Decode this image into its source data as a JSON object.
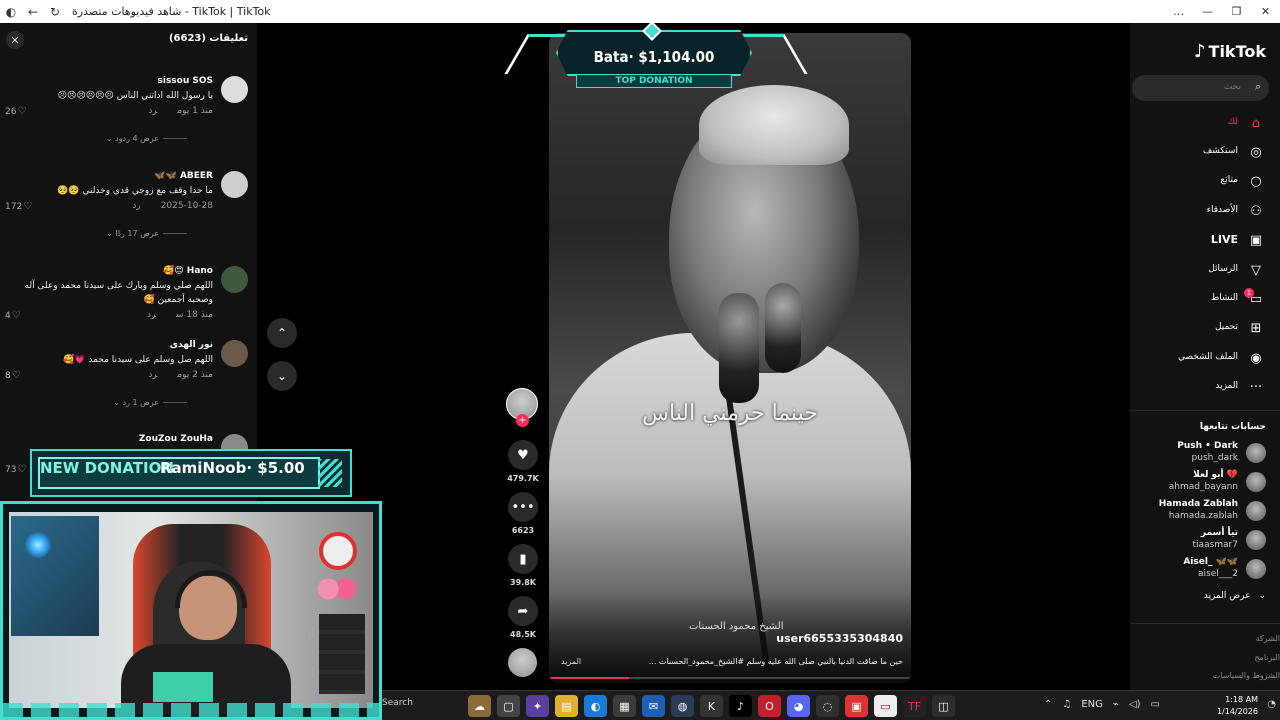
{
  "browser": {
    "title": "شاهد فيديوهات متصدرة - TikTok | TikTok",
    "icons": [
      "tiktok-favicon",
      "back-icon",
      "refresh-icon"
    ],
    "window_buttons": [
      "…",
      "—",
      "❐",
      "✕"
    ]
  },
  "comments_panel": {
    "title": "تعليقات (6623)",
    "close_label": "✕",
    "comments": [
      {
        "user": "sissou SOS",
        "text": "يا رسول الله اداتني الناس 😣😣😣😣😣😣",
        "meta": "منذ 1 يوم",
        "reply": "رد",
        "likes": "26",
        "replies": "عرض 4 ردود"
      },
      {
        "user": "ABEER 🦋🦋",
        "text": "ما حدا وقف مع زوجي قدي وخذلني 🥺🥺",
        "meta": "2025-10-28",
        "reply": "رد",
        "likes": "172",
        "replies": "عرض 17 ردًا"
      },
      {
        "user": "Hano 😍🥰",
        "text": "اللهم صلي وسلم وبارك على سيدنا محمد وعلى آله وصحبه أجمعين 🥰",
        "meta": "منذ 18 س",
        "reply": "رد",
        "likes": "4",
        "replies": ""
      },
      {
        "user": "نور الهدى",
        "text": "اللهم صل وسلم على سيدنا محمد 💗🥰",
        "meta": "منذ 2 يوم",
        "reply": "رد",
        "likes": "8",
        "replies": "عرض 1 رد"
      },
      {
        "user": "ZouZou ZouHa",
        "text": "",
        "meta": "",
        "reply": "",
        "likes": "73",
        "replies": ""
      }
    ]
  },
  "feed": {
    "nav_up": "⌃",
    "nav_down": "⌄",
    "video": {
      "overlay_text": "حينما حرمني الناس",
      "signature": "الشيخ محمود الحسنات",
      "username": "user6655335304840",
      "description": "حين ما ضاقت الدنيا بالنبي صلى الله عليه وسلم #الشيخ_محمود_الحسنات ...",
      "more": "المزيد",
      "progress": 0.22
    },
    "actions": {
      "follow": "+",
      "likes": "479.7K",
      "comments": "6623",
      "saves": "39.8K",
      "shares": "48.5K"
    }
  },
  "overlays": {
    "top_donation_amount": "Bata· $1,104.00",
    "top_donation_label": "TOP DONATION",
    "new_donation_label": "NEW DONATION",
    "new_donation_value": "RamiNoob· $5.00"
  },
  "sidebar": {
    "logo": "TikTok",
    "search_placeholder": "بحث",
    "nav": [
      {
        "label": "لك",
        "icon": "home-icon",
        "active": true
      },
      {
        "label": "استكشف",
        "icon": "compass-icon",
        "active": false
      },
      {
        "label": "متابَع",
        "icon": "following-icon",
        "active": false
      },
      {
        "label": "الأصدقاء",
        "icon": "friends-icon",
        "active": false
      },
      {
        "label": "LIVE",
        "icon": "live-icon",
        "active": false
      },
      {
        "label": "الرسائل",
        "icon": "messages-icon",
        "active": false
      },
      {
        "label": "النشاط",
        "icon": "activity-icon",
        "active": false
      },
      {
        "label": "تحميل",
        "icon": "upload-icon",
        "active": false
      },
      {
        "label": "الملف الشخصي",
        "icon": "profile-icon",
        "active": false
      },
      {
        "label": "المزيد",
        "icon": "more-icon",
        "active": false
      }
    ],
    "activity_badge": "1",
    "following_title": "حسابات تتابعها",
    "following": [
      {
        "name": "Push • Dark",
        "handle": "push_dark"
      },
      {
        "name": "أبو لعلا 💔",
        "handle": "ahmad_bayann"
      },
      {
        "name": "Hamada Zablah",
        "handle": "hamada.zablah"
      },
      {
        "name": "تيأ أسمر",
        "handle": "tiaasmar7"
      },
      {
        "name": "Aisel_ 🦋🦋",
        "handle": "aisel___2"
      }
    ],
    "see_more": "عرض المزيد",
    "footer": [
      "الشركة",
      "البرنامج",
      "الشروط والسياسات"
    ]
  },
  "taskbar": {
    "search": "Search",
    "tray_lang": "ENG",
    "time": "1:18 AM",
    "date": "1/14/2026"
  }
}
